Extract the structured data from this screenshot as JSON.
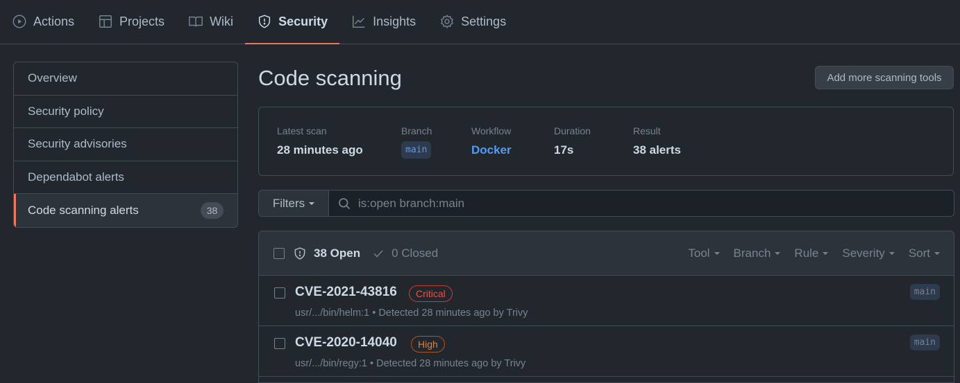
{
  "topnav": {
    "tabs": [
      {
        "label": "Actions",
        "icon": "play-circle-icon",
        "active": false
      },
      {
        "label": "Projects",
        "icon": "table-icon",
        "active": false
      },
      {
        "label": "Wiki",
        "icon": "book-icon",
        "active": false
      },
      {
        "label": "Security",
        "icon": "shield-icon",
        "active": true
      },
      {
        "label": "Insights",
        "icon": "graph-icon",
        "active": false
      },
      {
        "label": "Settings",
        "icon": "gear-icon",
        "active": false
      }
    ]
  },
  "sidebar": {
    "items": [
      {
        "label": "Overview"
      },
      {
        "label": "Security policy"
      },
      {
        "label": "Security advisories"
      },
      {
        "label": "Dependabot alerts"
      },
      {
        "label": "Code scanning alerts",
        "count": "38",
        "active": true
      }
    ]
  },
  "main": {
    "title": "Code scanning",
    "add_button": "Add more scanning tools",
    "scan": {
      "latest_label": "Latest scan",
      "latest_value": "28 minutes ago",
      "branch_label": "Branch",
      "branch_value": "main",
      "workflow_label": "Workflow",
      "workflow_value": "Docker",
      "duration_label": "Duration",
      "duration_value": "17s",
      "result_label": "Result",
      "result_value": "38 alerts"
    },
    "filter": {
      "button_label": "Filters",
      "search_value": "is:open branch:main"
    },
    "alerts_header": {
      "open_label": "38 Open",
      "closed_label": "0 Closed",
      "filters": [
        "Tool",
        "Branch",
        "Rule",
        "Severity",
        "Sort"
      ]
    },
    "alerts": [
      {
        "title": "CVE-2021-43816",
        "severity": "Critical",
        "meta": "usr/.../bin/helm:1 • Detected 28 minutes ago by Trivy",
        "branch": "main"
      },
      {
        "title": "CVE-2020-14040",
        "severity": "High",
        "meta": "usr/.../bin/regy:1 • Detected 28 minutes ago by Trivy",
        "branch": "main"
      }
    ]
  },
  "colors": {
    "accent": "#ec775c",
    "link": "#539bf5",
    "critical": "#e5534b",
    "high": "#e0823d",
    "background": "#22272e"
  }
}
